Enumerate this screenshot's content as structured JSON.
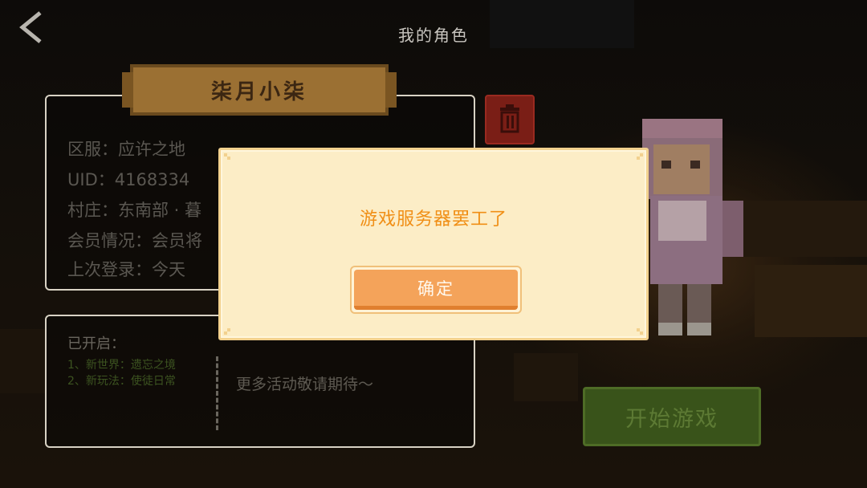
{
  "header": {
    "title": "我的角色"
  },
  "character": {
    "name": "柒月小柒"
  },
  "info": {
    "lines": [
      {
        "label": "区服：",
        "value": "应许之地"
      },
      {
        "label": "UID：",
        "value": "4168334"
      },
      {
        "label": "村庄：",
        "value": "东南部 · 暮"
      },
      {
        "label": "会员情况：",
        "value": "会员将"
      },
      {
        "label": "上次登录：",
        "value": "今天"
      }
    ]
  },
  "activities": {
    "heading": "已开启：",
    "items": [
      "1、新世界：遗忘之境",
      "2、新玩法：使徒日常"
    ],
    "more": "更多活动敬请期待～"
  },
  "start_button": {
    "label": "开始游戏"
  },
  "dialog": {
    "message": "游戏服务器罢工了",
    "confirm_label": "确定"
  },
  "icons": {
    "back": "back-chevron-icon",
    "trash": "trash-icon"
  },
  "colors": {
    "dialog_bg": "#fcedc6",
    "dialog_text": "#f08f16",
    "confirm_button": "#f4a35a",
    "start_button": "#39531a",
    "trash_button": "#7a1e16",
    "name_banner": "#9b7033"
  }
}
